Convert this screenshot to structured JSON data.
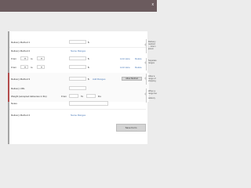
{
  "topbar": {
    "close_label": "x"
  },
  "rows": {
    "dm1_label": "Delivery Method 1",
    "dm1_currency": "$",
    "dm2_label": "Delivery Method 2",
    "dm2_link": "Name Ranges",
    "from_label": "From",
    "to_label": "to",
    "row_link_a": "Link Here",
    "row_link_b": "Delete",
    "dm3_label": "Delivery Method 3",
    "dm3_link": "Add Ranges",
    "add_button": "Allow Method",
    "dm4_label": "Delivery URL",
    "weight_label": "Weight (accepted deliveries in lbs)",
    "from2_label": "From",
    "to2_label": "To",
    "unit_label": "lbs",
    "notes_label": "Notes",
    "dm5_label": "Delivery Method 4",
    "dm5_link": "Name Ranges"
  },
  "side": {
    "note1": "Delivery method ... lorem ipsum",
    "note2": "Separate ranges",
    "note3": "Allow a range of shipping",
    "note4": "When a range fee ... delivery"
  },
  "footer": {
    "save_label": "Save Form"
  }
}
